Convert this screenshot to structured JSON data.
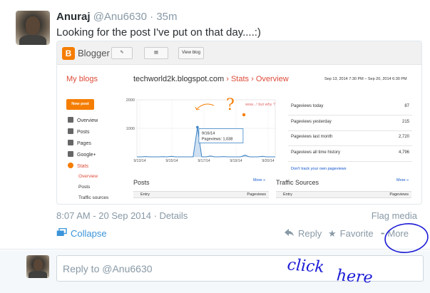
{
  "tweet": {
    "full_name": "Anuraj",
    "screen_name": "@Anu6630",
    "time": "· 35m",
    "text": "Looking for the post I've put on that day....:)",
    "timestamp": "8:07 AM - 20 Sep 2014",
    "details_sep": " · ",
    "details": "Details",
    "flag": "Flag media"
  },
  "actions": {
    "collapse": "Collapse",
    "reply": "Reply",
    "favorite": "Favorite",
    "more": "More",
    "more_dots": "•••"
  },
  "reply": {
    "placeholder": "Reply to @Anu6630"
  },
  "annotation": {
    "text": "click here",
    "color": "#1a1ad6"
  },
  "blogger": {
    "app_name": "Blogger",
    "view_blog": "View blog",
    "my_blogs": "My blogs",
    "blog_url": "techworld2k.blogspot.com",
    "sep": " › ",
    "crumb_stats": "Stats",
    "crumb_overview": "Overview",
    "date_range": "Sep 13, 2014 7:30 PM – Sep 20, 2014 6:30 PM",
    "new_post": "New post",
    "nav": [
      {
        "label": "Overview",
        "icon": "overview-icon"
      },
      {
        "label": "Posts",
        "icon": "posts-icon"
      },
      {
        "label": "Pages",
        "icon": "pages-icon"
      },
      {
        "label": "Google+",
        "icon": "google-plus-icon"
      },
      {
        "label": "Stats",
        "icon": "stats-icon"
      }
    ],
    "nav_sub": [
      "Overview",
      "Posts",
      "Traffic sources"
    ],
    "stats": [
      {
        "label": "Pageviews today",
        "value": "87"
      },
      {
        "label": "Pageviews yesterday",
        "value": "215"
      },
      {
        "label": "Pageviews last month",
        "value": "2,720"
      },
      {
        "label": "Pageviews all time history",
        "value": "4,796"
      }
    ],
    "track_link": "Don't track your own pageviews",
    "posts_title": "Posts",
    "traffic_title": "Traffic Sources",
    "more": "More »",
    "col_entry": "Entry",
    "col_pageviews": "Pageviews",
    "annotation_text": "wow...! but why ?",
    "annotation_mark": "?",
    "accent": "#f57d00"
  },
  "chart_data": {
    "type": "line",
    "ylim": [
      0,
      2000
    ],
    "yticks": [
      "2000",
      "1000"
    ],
    "x": [
      "9/13/14",
      "9/15/14",
      "9/17/14",
      "9/19/14",
      "9/20/14"
    ],
    "tooltip_date": "9/16/14",
    "tooltip_value": "Pageviews: 1,038",
    "series": [
      {
        "values": [
          0,
          0,
          10,
          0,
          0,
          0,
          5,
          0,
          20,
          0,
          0,
          0,
          0,
          0,
          1038,
          0,
          0,
          30,
          0,
          0,
          10,
          0,
          0,
          0,
          0,
          60,
          0,
          0,
          0,
          20,
          0,
          0,
          0
        ]
      }
    ],
    "color": "#3d85c6"
  }
}
